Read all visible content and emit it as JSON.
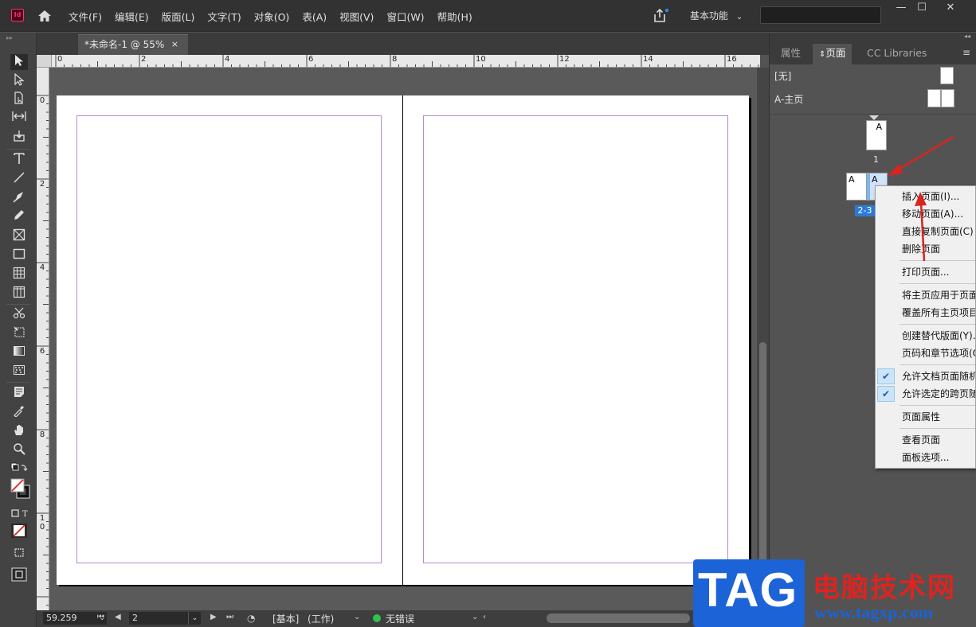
{
  "app": {
    "logo": "Id",
    "menu": [
      "文件(F)",
      "编辑(E)",
      "版面(L)",
      "文字(T)",
      "对象(O)",
      "表(A)",
      "视图(V)",
      "窗口(W)",
      "帮助(H)"
    ],
    "workspace": "基本功能",
    "window_buttons": [
      "—",
      "☐",
      "✕"
    ]
  },
  "document": {
    "tab_title": "*未命名-1 @ 55%",
    "tab_close": "×"
  },
  "ruler": {
    "h_labels": [
      "0",
      "2",
      "4",
      "6",
      "8",
      "10",
      "12",
      "14",
      "16"
    ],
    "v_labels": [
      "0",
      "2",
      "4",
      "6",
      "8",
      "1 0"
    ]
  },
  "status": {
    "zoom": "59.259",
    "page": "2",
    "master": "[基本]",
    "mode": "(工作)",
    "preflight": "无错误"
  },
  "panel": {
    "tabs": [
      "属性",
      "页面",
      "CC Libraries"
    ],
    "masters": [
      {
        "label": "[无]"
      },
      {
        "label": "A-主页"
      }
    ],
    "page1": {
      "letter": "A",
      "number": "1"
    },
    "spread": {
      "left_letter": "A",
      "right_letter": "A",
      "number": "2-3"
    }
  },
  "context_menu": {
    "items": [
      {
        "label": "插入页面(I)...",
        "checked": false
      },
      {
        "label": "移动页面(A)...",
        "checked": false
      },
      {
        "label": "直接复制页面(C)",
        "checked": false
      },
      {
        "label": "删除页面",
        "checked": false
      },
      {
        "label": "打印页面...",
        "checked": false
      },
      {
        "label": "将主页应用于页面",
        "checked": false
      },
      {
        "label": "覆盖所有主页项目",
        "checked": false
      },
      {
        "label": "创建替代版面(Y)...",
        "checked": false
      },
      {
        "label": "页码和章节选项(O)",
        "checked": false
      },
      {
        "label": "允许文档页面随机",
        "checked": true
      },
      {
        "label": "允许选定的跨页随",
        "checked": true
      },
      {
        "label": "页面属性",
        "checked": false
      },
      {
        "label": "查看页面",
        "checked": false
      },
      {
        "label": "面板选项...",
        "checked": false
      }
    ]
  },
  "watermark": {
    "tag": "TAG",
    "title": "电脑技术网",
    "url": "www.tagxp.com"
  },
  "colors": {
    "accent": "#2d7ad6",
    "arrow": "#d9241f",
    "margin_guide": "#b58ad4"
  }
}
